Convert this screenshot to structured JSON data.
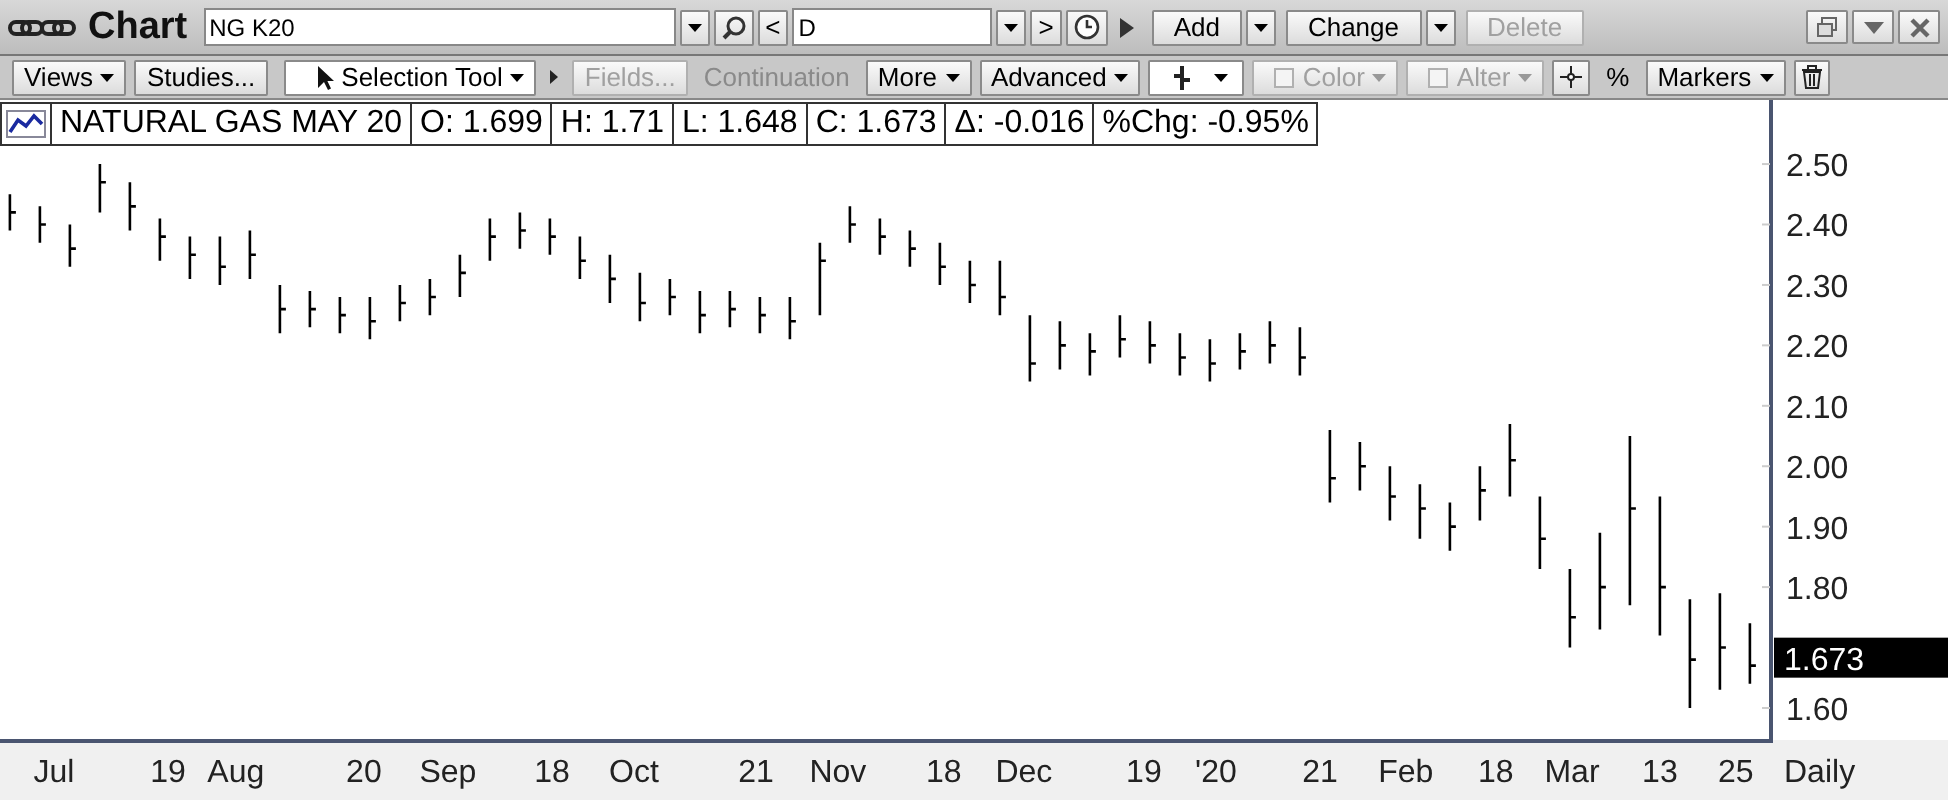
{
  "window": {
    "title": "Chart"
  },
  "toolbar": {
    "symbol": "NG K20",
    "prev_label": "<",
    "interval": "D",
    "next_label": ">",
    "buttons": [
      {
        "label": "Add",
        "disabled": false,
        "dropdown": true
      },
      {
        "label": "Change",
        "disabled": false,
        "dropdown": true
      },
      {
        "label": "Delete",
        "disabled": true,
        "dropdown": false
      }
    ]
  },
  "tools": [
    {
      "kind": "menu",
      "label": "Views",
      "disabled": false
    },
    {
      "kind": "button",
      "label": "Studies...",
      "disabled": false
    },
    {
      "kind": "tool",
      "label": "Selection Tool",
      "disabled": false
    },
    {
      "kind": "expander",
      "disabled": false
    },
    {
      "kind": "button",
      "label": "Fields...",
      "disabled": true
    },
    {
      "kind": "label",
      "label": "Continuation",
      "disabled": true
    },
    {
      "kind": "menu",
      "label": "More",
      "disabled": false
    },
    {
      "kind": "menu",
      "label": "Advanced",
      "disabled": false
    },
    {
      "kind": "bar-style",
      "disabled": false
    },
    {
      "kind": "check-menu",
      "label": "Color",
      "disabled": true
    },
    {
      "kind": "check-menu",
      "label": "Alter",
      "disabled": true
    },
    {
      "kind": "crosshair",
      "disabled": false
    },
    {
      "kind": "label",
      "label": "%",
      "disabled": false
    },
    {
      "kind": "menu",
      "label": "Markers",
      "disabled": false
    },
    {
      "kind": "trash",
      "disabled": false
    }
  ],
  "legend": {
    "name": "NATURAL GAS MAY 20",
    "fields": [
      "O: 1.699",
      "H: 1.71",
      "L: 1.648",
      "C: 1.673",
      "Δ: -0.016",
      "%Chg: -0.95%"
    ]
  },
  "chart": {
    "last_price": "1.673",
    "period": "Daily",
    "y_axis_labels": [
      "2.50",
      "2.40",
      "2.30",
      "2.20",
      "2.10",
      "2.00",
      "1.90",
      "1.80",
      "1.60"
    ],
    "x_axis_labels": [
      "Jul",
      "19",
      "Aug",
      "20",
      "Sep",
      "18",
      "Oct",
      "21",
      "Nov",
      "18",
      "Dec",
      "19",
      "'20",
      "21",
      "Feb",
      "18",
      "Mar",
      "13",
      "25"
    ]
  }
}
